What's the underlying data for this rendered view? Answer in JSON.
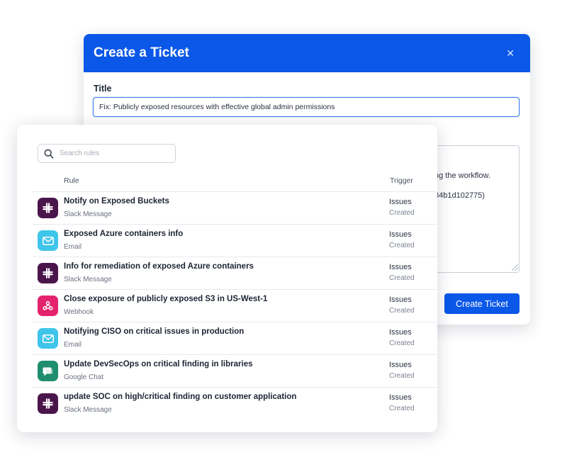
{
  "ticket": {
    "heading": "Create a Ticket",
    "title_label": "Title",
    "title_value": "Fix: Publicly exposed resources with effective global admin permissions",
    "description_lines": [
      "ng the workflow.",
      "34b1d102775)"
    ],
    "create_button_label": "Create Ticket",
    "colors": {
      "header": "#0a57e8",
      "button": "#0a57e8"
    }
  },
  "rules_panel": {
    "search_placeholder": "Search rules",
    "columns": {
      "rule": "Rule",
      "trigger": "Trigger"
    },
    "rules": [
      {
        "name": "Notify on Exposed Buckets",
        "channel": "Slack Message",
        "trigger": "Issues",
        "trigger_sub": "Created",
        "icon": "slack-icon",
        "icon_color": "#4a154b"
      },
      {
        "name": "Exposed Azure containers info",
        "channel": "Email",
        "trigger": "Issues",
        "trigger_sub": "Created",
        "icon": "email-icon",
        "icon_color": "#3fc4ea"
      },
      {
        "name": "Info for remediation of exposed Azure containers",
        "channel": "Slack Message",
        "trigger": "Issues",
        "trigger_sub": "Created",
        "icon": "slack-icon",
        "icon_color": "#4a154b"
      },
      {
        "name": "Close exposure of publicly exposed S3 in US-West-1",
        "channel": "Webhook",
        "trigger": "Issues",
        "trigger_sub": "Created",
        "icon": "webhook-icon",
        "icon_color": "#e5226e"
      },
      {
        "name": "Notifying CISO on critical issues in production",
        "channel": "Email",
        "trigger": "Issues",
        "trigger_sub": "Created",
        "icon": "email-icon",
        "icon_color": "#3fc4ea"
      },
      {
        "name": "Update DevSecOps on critical finding in libraries",
        "channel": "Google Chat",
        "trigger": "Issues",
        "trigger_sub": "Created",
        "icon": "google-chat-icon",
        "icon_color": "#1e8e6e"
      },
      {
        "name": "update SOC on high/critical finding on customer application",
        "channel": "Slack Message",
        "trigger": "Issues",
        "trigger_sub": "Created",
        "icon": "slack-icon",
        "icon_color": "#4a154b"
      }
    ]
  }
}
